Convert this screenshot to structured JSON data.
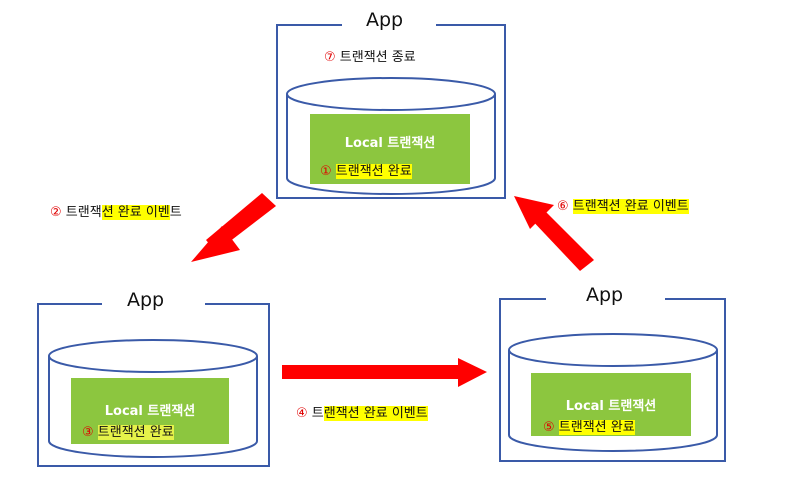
{
  "colors": {
    "app_border": "#3a5aa8",
    "green_box": "#8cc63f",
    "arrow": "#ff0000",
    "highlight": "#ffff00",
    "step_number": "#e00000"
  },
  "top_app": {
    "title": "App",
    "end_label": {
      "num": "⑦",
      "text": "트랜잭션 종료"
    },
    "local_label": "Local 트랜잭션",
    "status": {
      "num": "①",
      "text": "트랜잭션 완료"
    }
  },
  "left_app": {
    "title": "App",
    "local_label": "Local 트랜잭션",
    "status": {
      "num": "③",
      "text": "트랜잭션 완료"
    }
  },
  "right_app": {
    "title": "App",
    "local_label": "Local 트랜잭션",
    "status": {
      "num": "⑤",
      "text": "트랜잭션 완료"
    }
  },
  "events": {
    "e2": {
      "num": "②",
      "pre": "트랜잭",
      "hl": "션 완료 이벤",
      "post": "트"
    },
    "e4": {
      "num": "④",
      "pre": "트",
      "hl": "랜잭션 완료 이벤트"
    },
    "e6": {
      "num": "⑥",
      "hl": "트랜잭션 완료 이벤트"
    }
  }
}
